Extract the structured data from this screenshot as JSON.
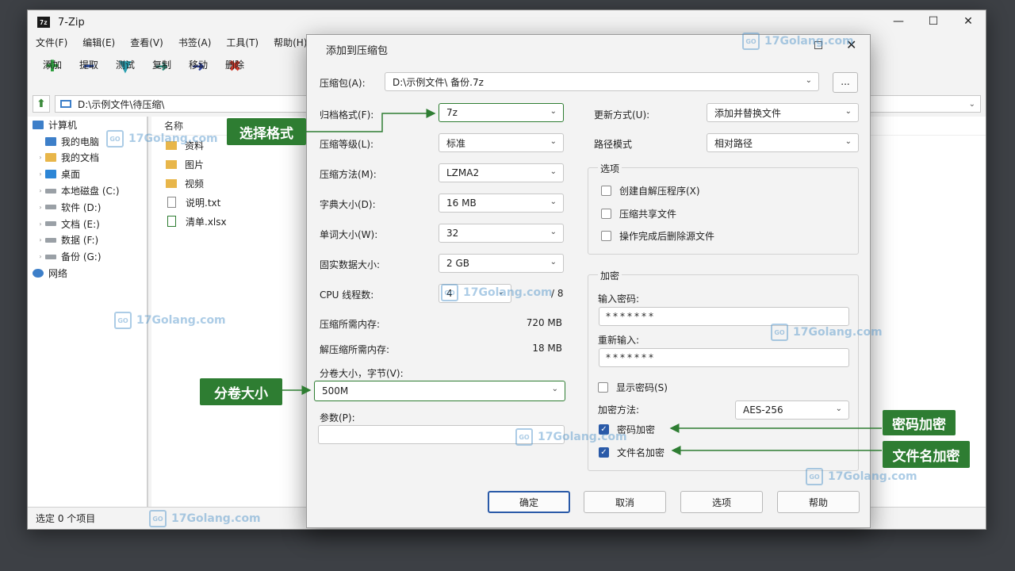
{
  "app": {
    "title": "7-Zip",
    "icon_text": "7z",
    "controls": {
      "minimize": "—",
      "maximize": "☐",
      "close": "✕"
    },
    "menu": [
      "文件(F)",
      "编辑(E)",
      "查看(V)",
      "书签(A)",
      "工具(T)",
      "帮助(H)"
    ],
    "toolbar": [
      {
        "label": "添加",
        "icon": "plus-icon",
        "glyph": "✚",
        "color": "#2e9e3e"
      },
      {
        "label": "提取",
        "icon": "minus-icon",
        "glyph": "━",
        "color": "#2a4fa8"
      },
      {
        "label": "测试",
        "icon": "check-icon",
        "glyph": "▼",
        "color": "#2a9fb0"
      },
      {
        "label": "复制",
        "icon": "copy-arrow-icon",
        "glyph": "➜",
        "color": "#2a8a7a"
      },
      {
        "label": "移动",
        "icon": "move-arrow-icon",
        "glyph": "➜",
        "color": "#2a3f9a"
      },
      {
        "label": "删除",
        "icon": "delete-icon",
        "glyph": "✖",
        "color": "#d23a2a"
      }
    ],
    "address": "D:\\示例文件\\待压缩\\",
    "tree": [
      {
        "label": "计算机",
        "icon": "pc",
        "indent": 0,
        "arrow": ""
      },
      {
        "label": "我的电脑",
        "icon": "pc",
        "indent": 1,
        "arrow": ""
      },
      {
        "label": "我的文档",
        "icon": "folder",
        "indent": 1,
        "arrow": "›"
      },
      {
        "label": "桌面",
        "icon": "desk",
        "indent": 1,
        "arrow": "›"
      },
      {
        "label": "本地磁盘 (C:)",
        "icon": "drive",
        "indent": 1,
        "arrow": "›"
      },
      {
        "label": "软件 (D:)",
        "icon": "drive",
        "indent": 1,
        "arrow": "›"
      },
      {
        "label": "文档 (E:)",
        "icon": "drive",
        "indent": 1,
        "arrow": "›"
      },
      {
        "label": "数据 (F:)",
        "icon": "drive",
        "indent": 1,
        "arrow": "›"
      },
      {
        "label": "备份 (G:)",
        "icon": "drive",
        "indent": 1,
        "arrow": "›"
      },
      {
        "label": "网络",
        "icon": "net",
        "indent": 0,
        "arrow": ""
      }
    ],
    "file_header": "名称",
    "files": [
      {
        "name": "资料",
        "type": "folder"
      },
      {
        "name": "图片",
        "type": "folder"
      },
      {
        "name": "视频",
        "type": "folder"
      },
      {
        "name": "说明.txt",
        "type": "txt"
      },
      {
        "name": "清单.xlsx",
        "type": "xls"
      }
    ],
    "status": "选定 0 个项目"
  },
  "dialog": {
    "title": "添加到压缩包",
    "archive_label": "压缩包(A):",
    "archive_value": "D:\\示例文件\\ 备份.7z",
    "browse_label": "...",
    "format_label": "归档格式(F):",
    "format_value": "7z",
    "level_label": "压缩等级(L):",
    "level_value": "标准",
    "method_label": "压缩方法(M):",
    "method_value": "LZMA2",
    "dict_label": "字典大小(D):",
    "dict_value": "16 MB",
    "word_label": "单词大小(W):",
    "word_value": "32",
    "solid_label": "固实数据大小:",
    "solid_value": "2 GB",
    "cpu_label": "CPU 线程数:",
    "cpu_value": "4",
    "cpu_total": "/ 8",
    "mem_c_label": "压缩所需内存:",
    "mem_c_value": "720 MB",
    "mem_d_label": "解压缩所需内存:",
    "mem_d_value": "18 MB",
    "split_label": "分卷大小，字节(V):",
    "split_value": "500M",
    "params_label": "参数(P):",
    "params_value": "",
    "update_label": "更新方式(U):",
    "update_value": "添加并替换文件",
    "path_label": "路径模式",
    "path_value": "相对路径",
    "options_title": "选项",
    "opt_sfx": "创建自解压程序(X)",
    "opt_shared": "压缩共享文件",
    "opt_delete": "操作完成后删除源文件",
    "enc_title": "加密",
    "pwd_label": "输入密码:",
    "pwd_value": "*******",
    "repwd_label": "重新输入:",
    "repwd_value": "*******",
    "show_pwd": "显示密码(S)",
    "enc_method_label": "加密方法:",
    "enc_method_value": "AES-256",
    "enc_pwd": "密码加密",
    "enc_names": "文件名加密",
    "btn_ok": "确定",
    "btn_cancel": "取消",
    "btn_options": "选项",
    "btn_help": "帮助"
  },
  "callouts": {
    "format": "选择格式",
    "split": "分卷大小",
    "pwd": "密码加密",
    "names": "文件名加密",
    "color": "#2e7d32"
  },
  "watermark": {
    "text": "17Golang.com",
    "badge": "GO"
  }
}
